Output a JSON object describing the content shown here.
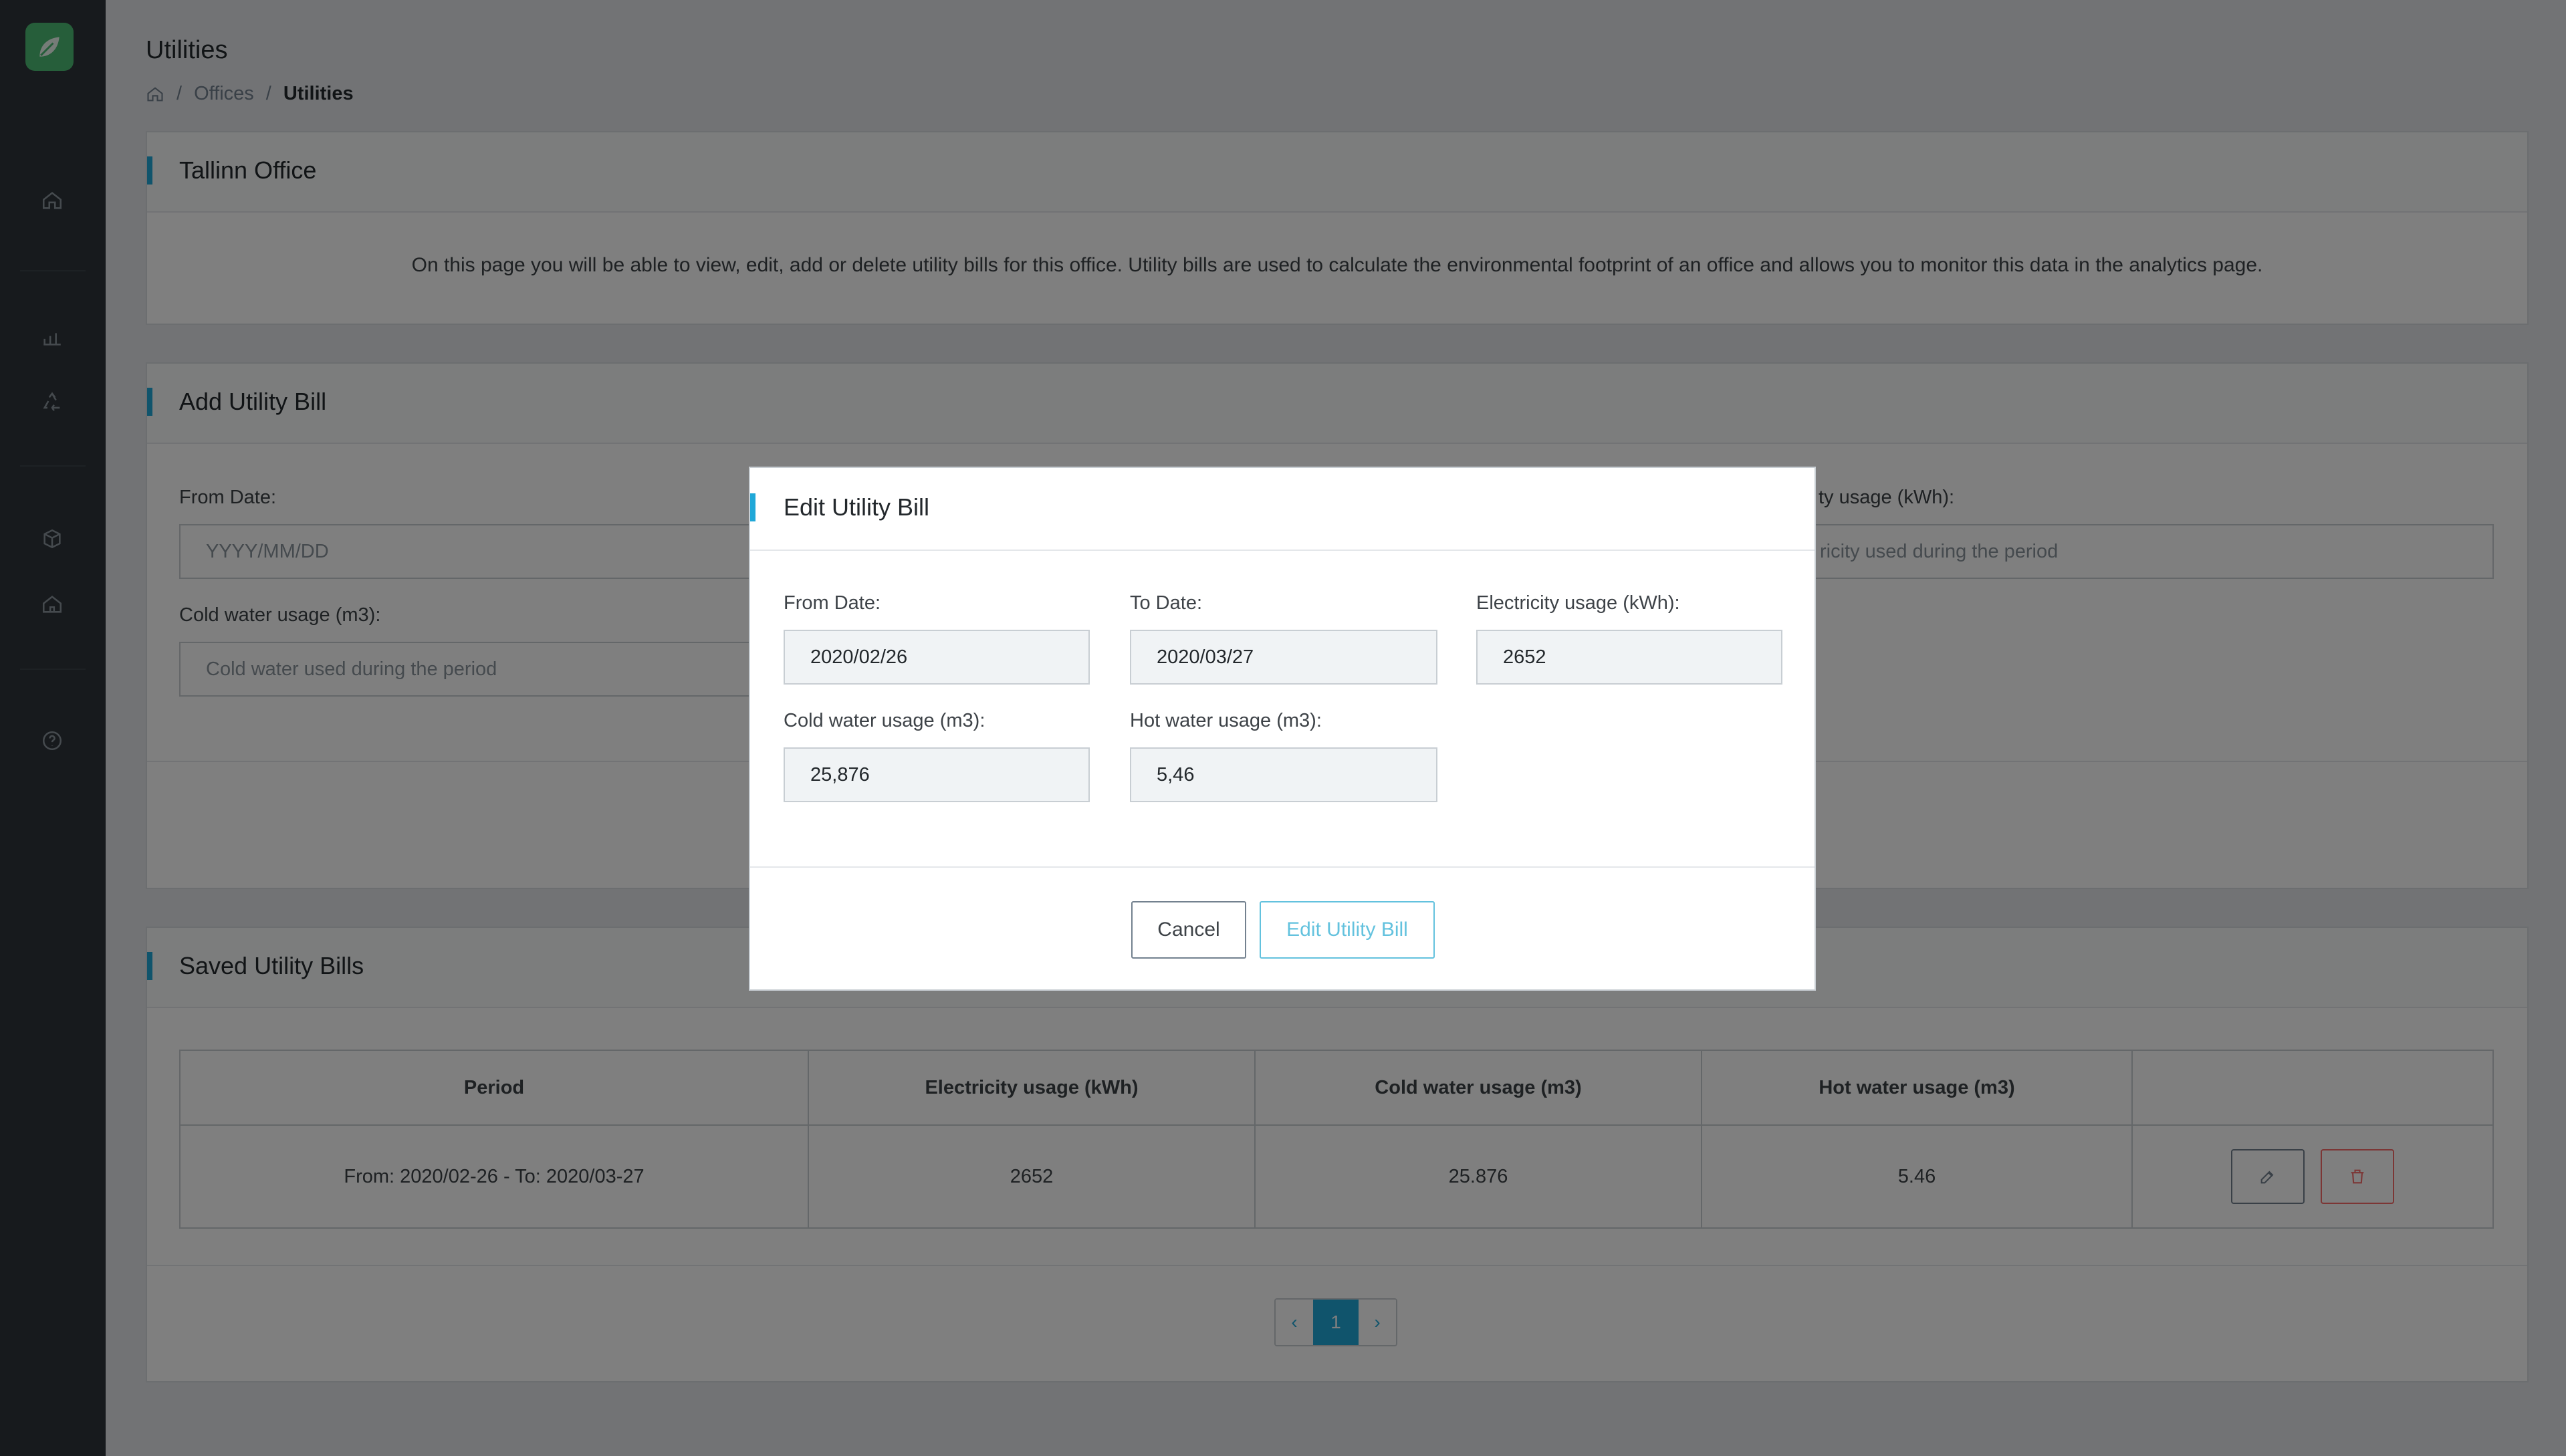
{
  "page": {
    "title": "Utilities",
    "breadcrumb": {
      "offices": "Offices",
      "current": "Utilities"
    }
  },
  "office_card": {
    "title": "Tallinn Office",
    "description": "On this page you will be able to view, edit, add or delete utility bills for this office. Utility bills are used to calculate the environmental footprint of an office and allows you to monitor this data in the analytics page."
  },
  "add_card": {
    "title": "Add Utility Bill",
    "from_label": "From Date:",
    "from_placeholder": "YYYY/MM/DD",
    "cold_label": "Cold water usage (m3):",
    "cold_placeholder": "Cold water used during the period",
    "elec_label_partial": "ty usage (kWh):",
    "elec_placeholder_partial": "ricity used during the period"
  },
  "saved_card": {
    "title": "Saved Utility Bills",
    "columns": [
      "Period",
      "Electricity usage (kWh)",
      "Cold water usage (m3)",
      "Hot water usage (m3)"
    ],
    "rows": [
      {
        "period": "From: 2020/02-26 - To: 2020/03-27",
        "electricity": "2652",
        "cold": "25.876",
        "hot": "5.46"
      }
    ],
    "pagination": {
      "prev": "‹",
      "current": "1",
      "next": "›"
    }
  },
  "modal": {
    "title": "Edit Utility Bill",
    "from_label": "From Date:",
    "from_value": "2020/02/26",
    "to_label": "To Date:",
    "to_value": "2020/03/27",
    "elec_label": "Electricity usage (kWh):",
    "elec_value": "2652",
    "cold_label": "Cold water usage (m3):",
    "cold_value": "25,876",
    "hot_label": "Hot water usage (m3):",
    "hot_value": "5,46",
    "cancel_label": "Cancel",
    "submit_label": "Edit Utility Bill"
  },
  "colors": {
    "accent": "#20a8d8",
    "sidebar": "#2f353a",
    "logo": "#4dbd74",
    "danger": "#f86c6b"
  },
  "icons": {
    "sidebar": [
      "leaf-icon",
      "home-icon",
      "bar-chart-icon",
      "recycle-icon",
      "box-icon",
      "building-icon",
      "help-icon"
    ],
    "row_actions": [
      "edit-icon",
      "trash-icon"
    ]
  }
}
